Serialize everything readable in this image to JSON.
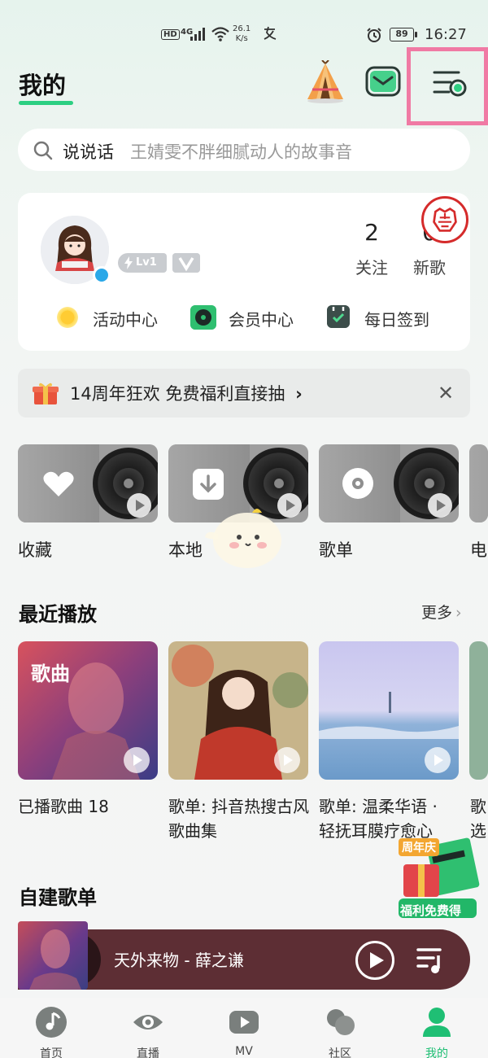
{
  "status_bar": {
    "hd": "HD",
    "network": "4G",
    "speed_value": "26.1",
    "speed_unit": "K/s",
    "battery": "89",
    "time": "16:27"
  },
  "header": {
    "title": "我的",
    "icons": [
      "tent-icon",
      "mail-icon",
      "menu-settings-icon"
    ],
    "accent_color": "#2ccf82",
    "highlight_color": "#f07aa4"
  },
  "search": {
    "label": "说说话",
    "placeholder": "王婧雯不胖细腻动人的故事音"
  },
  "profile": {
    "level": "Lv1",
    "stats": [
      {
        "value": "2",
        "label": "关注"
      },
      {
        "value": "0",
        "label": "新歌"
      }
    ],
    "links": [
      {
        "label": "活动中心",
        "icon": "sun-icon"
      },
      {
        "label": "会员中心",
        "icon": "vip-record-icon"
      },
      {
        "label": "每日签到",
        "icon": "calendar-check-icon"
      }
    ]
  },
  "banner": {
    "text": "14周年狂欢 免费福利直接抽",
    "chevron": "›",
    "close": "✕"
  },
  "collections": [
    {
      "label": "收藏",
      "icon": "heart-icon"
    },
    {
      "label": "本地",
      "icon": "download-icon"
    },
    {
      "label": "歌单",
      "icon": "disc-icon"
    },
    {
      "label": "电",
      "icon": "radio-icon"
    }
  ],
  "recent": {
    "title": "最近播放",
    "more": "更多",
    "items": [
      {
        "overlay": "歌曲",
        "title": "已播歌曲 18"
      },
      {
        "overlay": "",
        "title": "歌单: 抖音热搜古风歌曲集"
      },
      {
        "overlay": "",
        "title": "歌单: 温柔华语 · 轻抚耳膜疗愈心"
      },
      {
        "overlay": "",
        "title": "歌选"
      }
    ]
  },
  "promo_sticker": {
    "top": "周年庆",
    "bottom": "福利免费得"
  },
  "my_playlists": {
    "title": "自建歌单"
  },
  "player": {
    "now_playing": "天外来物 - 薛之谦"
  },
  "nav": {
    "items": [
      {
        "label": "首页",
        "icon": "home-note-icon"
      },
      {
        "label": "直播",
        "icon": "eye-icon"
      },
      {
        "label": "MV",
        "icon": "video-play-icon"
      },
      {
        "label": "社区",
        "icon": "community-icon"
      },
      {
        "label": "我的",
        "icon": "profile-icon"
      }
    ],
    "active_color": "#1fbf74"
  }
}
